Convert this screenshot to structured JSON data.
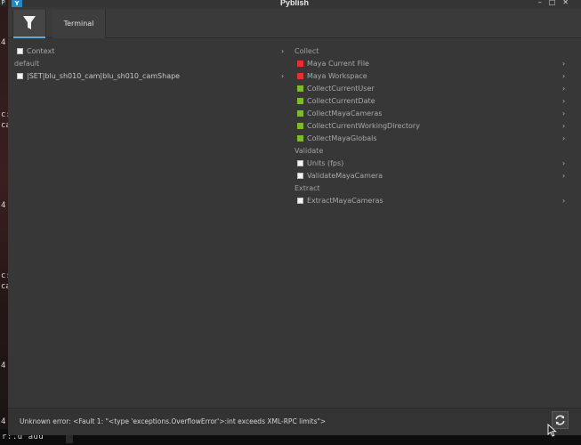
{
  "window": {
    "title": "Pyblish"
  },
  "tabs": [
    {
      "name": "filter",
      "icon": "filter-icon"
    },
    {
      "name": "terminal",
      "label": "Terminal"
    }
  ],
  "instances": {
    "context_label": "Context",
    "group_label": "default",
    "items": [
      {
        "label": "|SET|blu_sh010_cam|blu_sh010_camShape"
      }
    ]
  },
  "plugins": {
    "sections": [
      {
        "title": "Collect",
        "items": [
          {
            "label": "Maya Current File",
            "status": "error",
            "color": "#e53030"
          },
          {
            "label": "Maya Workspace",
            "status": "error",
            "color": "#e53030"
          },
          {
            "label": "CollectCurrentUser",
            "status": "ok",
            "color": "#7dbb2c"
          },
          {
            "label": "CollectCurrentDate",
            "status": "ok",
            "color": "#7dbb2c"
          },
          {
            "label": "CollectMayaCameras",
            "status": "ok",
            "color": "#7dbb2c"
          },
          {
            "label": "CollectCurrentWorkingDirectory",
            "status": "ok",
            "color": "#7dbb2c"
          },
          {
            "label": "CollectMayaGlobals",
            "status": "ok",
            "color": "#7dbb2c"
          }
        ]
      },
      {
        "title": "Validate",
        "items": [
          {
            "label": "Units (fps)",
            "status": "unchecked"
          },
          {
            "label": "ValidateMayaCamera",
            "status": "unchecked"
          }
        ]
      },
      {
        "title": "Extract",
        "items": [
          {
            "label": "ExtractMayaCameras",
            "status": "unchecked"
          }
        ]
      }
    ]
  },
  "footer": {
    "message": "Unknown error: <Fault 1: \"<type 'exceptions.OverflowError'>:int exceeds XML-RPC limits\">",
    "refresh_icon": "refresh-icon"
  },
  "background": {
    "left_chars": [
      "4",
      "c:",
      "ca",
      "4",
      "c:",
      "ca",
      "4",
      "4"
    ],
    "bottom_text": "r:.d  add",
    "corner_icon": "P"
  }
}
